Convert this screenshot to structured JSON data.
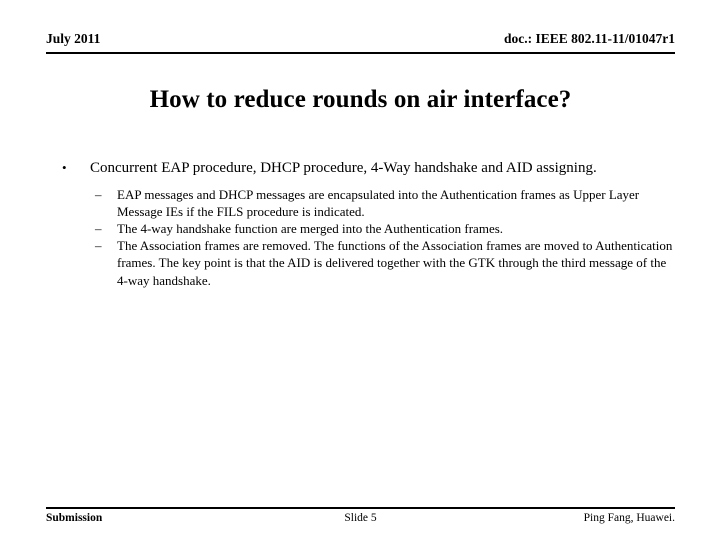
{
  "header": {
    "date": "July 2011",
    "doc_number": "doc.: IEEE 802.11-11/01047r1"
  },
  "title": "How to reduce rounds on air interface?",
  "content": {
    "bullets": [
      {
        "marker": "•",
        "text": "Concurrent EAP procedure, DHCP procedure, 4-Way handshake and AID assigning.",
        "sub_marker": "–",
        "sub_bullets": [
          "EAP messages and DHCP messages are encapsulated into the Authentication frames as Upper Layer Message IEs if the FILS procedure is indicated.",
          "The 4-way handshake function are merged into the Authentication frames.",
          "The Association frames are removed. The functions of the Association frames are moved to Authentication frames. The key point is that the AID is delivered together with the GTK through the third message of the 4-way handshake."
        ]
      }
    ]
  },
  "footer": {
    "left": "Submission",
    "center": "Slide 5",
    "right": "Ping Fang, Huawei."
  }
}
